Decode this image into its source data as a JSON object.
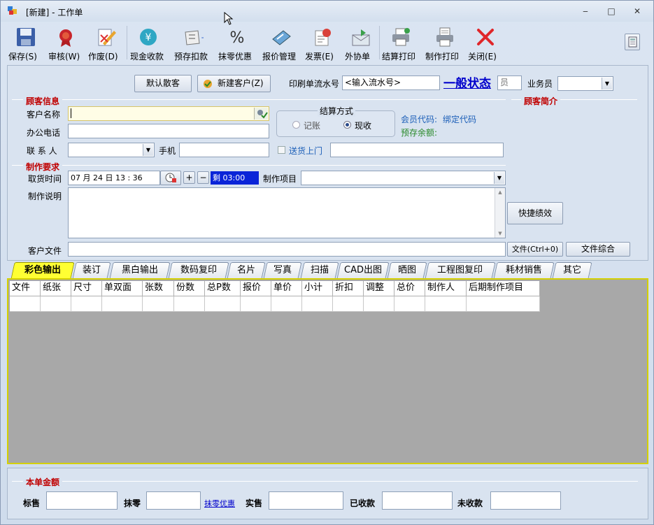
{
  "window": {
    "title": "[新建] - 工作单",
    "min": "‒",
    "max": "□",
    "close": "✕"
  },
  "toolbar": [
    {
      "label": "保存(S)",
      "icon": "save-icon"
    },
    {
      "label": "审核(W)",
      "icon": "seal-icon"
    },
    {
      "label": "作废(D)",
      "icon": "edit-void-icon"
    },
    {
      "label": "现金收款",
      "icon": "yen-coin-icon"
    },
    {
      "label": "预存扣款",
      "icon": "deposit-icon"
    },
    {
      "label": "抹零优惠",
      "icon": "percent-icon"
    },
    {
      "label": "报价管理",
      "icon": "price-icon"
    },
    {
      "label": "发票(E)",
      "icon": "invoice-icon"
    },
    {
      "label": "外协单",
      "icon": "outsource-icon"
    },
    {
      "label": "结算打印",
      "icon": "printer-icon"
    },
    {
      "label": "制作打印",
      "icon": "print-doc-icon"
    },
    {
      "label": "关闭(E)",
      "icon": "close-x-icon"
    }
  ],
  "top": {
    "default_customer": "默认散客",
    "new_customer": "新建客户(Z)",
    "serial_label": "印刷单流水号",
    "serial_value": "<输入流水号>",
    "status": "一般状态",
    "staff_value": "员",
    "salesman_label": "业务员",
    "salesman_value": ""
  },
  "customer": {
    "section": "顾客信息",
    "name_label": "客户名称",
    "name_value": "",
    "phone_label": "办公电话",
    "phone_value": "",
    "contact_label": "联 系 人",
    "contact_value": "",
    "mobile_label": "手机",
    "mobile_value": ""
  },
  "settlement": {
    "title": "结算方式",
    "opt1": "记账",
    "opt2": "现收"
  },
  "member": {
    "code_label": "会员代码:",
    "bind": "绑定代码",
    "balance_label": "预存余额:"
  },
  "delivery": {
    "label": "送货上门",
    "value": ""
  },
  "brief": {
    "section": "顾客简介"
  },
  "production": {
    "section": "制作要求",
    "pickup_label": "取货时间",
    "pickup_value": "07 月 24 日 13 : 36",
    "plus": "+",
    "minus": "−",
    "remain": "剩 03:00",
    "item_label": "制作项目",
    "item_value": "",
    "desc_label": "制作说明",
    "desc_value": "",
    "quick_button": "快捷绩效",
    "file_label": "客户文件",
    "file_value": "",
    "file_button": "文件(Ctrl+0)",
    "file_all": "文件综合"
  },
  "tabs": [
    "彩色输出",
    "装订",
    "黑白输出",
    "数码复印",
    "名片",
    "写真",
    "扫描",
    "CAD出图",
    "晒图",
    "工程图复印",
    "耗材销售",
    "其它"
  ],
  "grid": {
    "columns": [
      "文件",
      "纸张",
      "尺寸",
      "单双面",
      "张数",
      "份数",
      "总P数",
      "报价",
      "单价",
      "小计",
      "折扣",
      "调整",
      "总价",
      "制作人",
      "后期制作项目"
    ]
  },
  "amount": {
    "section": "本单金额",
    "std_label": "标售",
    "std_value": "",
    "round_label": "抹零",
    "round_value": "",
    "discount_link": "抹零优惠",
    "actual_label": "实售",
    "actual_value": "",
    "received_label": "已收款",
    "received_value": "",
    "unreceived_label": "未收款",
    "unreceived_value": ""
  }
}
